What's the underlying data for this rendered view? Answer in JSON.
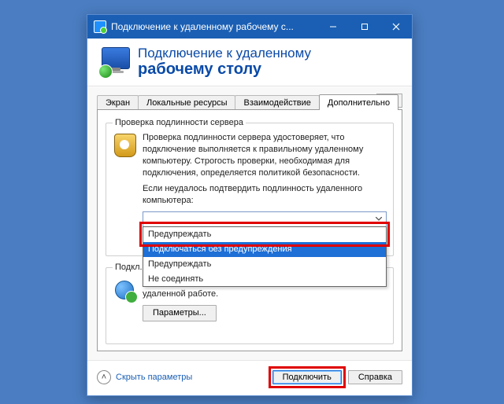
{
  "window": {
    "title": "Подключение к удаленному рабочему с...",
    "header_line1": "Подключение к удаленному",
    "header_line2": "рабочему столу"
  },
  "tabs": {
    "items": [
      "Экран",
      "Локальные ресурсы",
      "Взаимодействие",
      "Дополнительно"
    ],
    "active_index": 3
  },
  "group_auth": {
    "legend": "Проверка подлинности сервера",
    "desc": "Проверка подлинности сервера удостоверяет, что подключение выполняется к правильному удаленному компьютеру. Строгость проверки, необходимая для подключения, определяется политикой безопасности.",
    "prompt": "Если неудалось подтвердить подлинность удаленного компьютера:",
    "options": [
      "Предупреждать",
      "Подключаться без предупреждения",
      "Предупреждать",
      "Не соединять"
    ],
    "selected_index": 1
  },
  "group_gateway": {
    "legend": "Подкл...",
    "desc": "Настройка параметров для подключения через шлюз при удаленной работе.",
    "params_btn": "Параметры..."
  },
  "footer": {
    "toggle": "Скрыть параметры",
    "connect": "Подключить",
    "help": "Справка"
  },
  "chart_data": null
}
